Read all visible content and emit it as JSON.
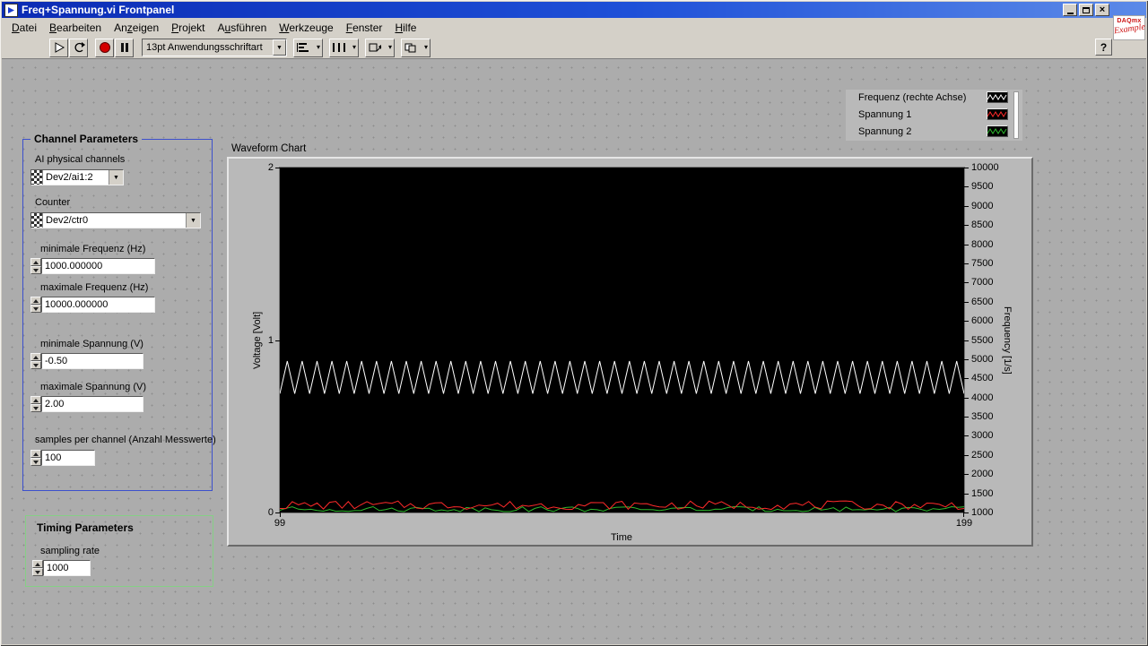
{
  "window": {
    "title": "Freq+Spannung.vi Frontpanel"
  },
  "icons": {
    "dropdown": "▼",
    "dropdown_small": "▾",
    "close": "×",
    "help": "?"
  },
  "menu": {
    "items": [
      {
        "label": "Datei",
        "accel": 0
      },
      {
        "label": "Bearbeiten",
        "accel": 0
      },
      {
        "label": "Anzeigen",
        "accel": 2
      },
      {
        "label": "Projekt",
        "accel": 0
      },
      {
        "label": "Ausführen",
        "accel": 1
      },
      {
        "label": "Werkzeuge",
        "accel": 0
      },
      {
        "label": "Fenster",
        "accel": 0
      },
      {
        "label": "Hilfe",
        "accel": 0
      }
    ]
  },
  "toolbar": {
    "font_selector": "13pt Anwendungsschriftart"
  },
  "badge": {
    "line1": "DAQmx",
    "line2": "Example"
  },
  "panel": {
    "channel_parameters": {
      "title": "Channel Parameters",
      "fields": [
        {
          "kind": "io-combo",
          "label": "AI physical channels",
          "value": "Dev2/ai1:2"
        },
        {
          "kind": "io-combo",
          "label": "Counter",
          "value": "Dev2/ctr0"
        },
        {
          "kind": "numeric",
          "label": "minimale Frequenz (Hz)",
          "value": "1000.000000"
        },
        {
          "kind": "numeric",
          "label": "maximale Frequenz (Hz)",
          "value": "10000.000000"
        },
        {
          "kind": "numeric",
          "label": "minimale Spannung (V)",
          "value": "-0.50"
        },
        {
          "kind": "numeric",
          "label": "maximale Spannung (V)",
          "value": "2.00"
        },
        {
          "kind": "numeric",
          "label": "samples per channel (Anzahl Messwerte)",
          "value": "100"
        }
      ]
    },
    "timing_parameters": {
      "title": "Timing Parameters",
      "fields": [
        {
          "kind": "numeric",
          "label": "sampling rate",
          "value": "1000"
        }
      ]
    }
  },
  "chart_data": {
    "type": "line",
    "title": "Waveform Chart",
    "xlabel": "Time",
    "x_range": [
      99,
      199
    ],
    "x_ticks": [
      99,
      199
    ],
    "plot_background": "#000000",
    "legend_position": "top-right-outside",
    "axes": {
      "left": {
        "label": "Voltage [Volt]",
        "range": [
          0,
          2
        ],
        "ticks": [
          2,
          1,
          0
        ]
      },
      "right": {
        "label": "Frequency [1/s]",
        "range": [
          1000,
          10000
        ],
        "tick_step": 500
      }
    },
    "series": [
      {
        "name": "Frequenz (rechte Achse)",
        "axis": "right",
        "color": "#ffffff",
        "shape": "triangle-wave",
        "min": 4100,
        "max": 4950,
        "cycles": 46
      },
      {
        "name": "Spannung 1",
        "axis": "left",
        "color": "#ff2a2a",
        "shape": "noisy-flat",
        "base": 0.035,
        "noise": 0.05,
        "seed": 7
      },
      {
        "name": "Spannung 2",
        "axis": "left",
        "color": "#2db82d",
        "shape": "noisy-flat",
        "base": 0.015,
        "noise": 0.03,
        "seed": 13
      }
    ]
  }
}
